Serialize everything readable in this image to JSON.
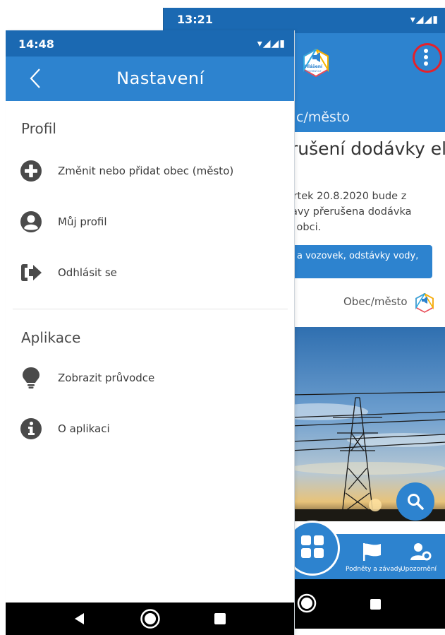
{
  "back_screen": {
    "status_time": "13:21",
    "status_icons": "▾◢◢▮",
    "logo_text_top": "Hlášení",
    "logo_text_bottom": "POCHYBNÝ.CZ",
    "appbar_title": "c/město",
    "headline": "rušení dodávky el.",
    "body_lines": [
      "vrtek 20.8.2020 bude z",
      "ravy přerušena dodávka",
      "é obci."
    ],
    "banner_text": "a vozovek, odstávky vody,",
    "source_label": "Obec/město",
    "nav": {
      "item2_label": "Podněty a závady",
      "item3_label": "Upozornění"
    }
  },
  "front_screen": {
    "status_time": "14:48",
    "status_icons": "▾◢◢▮",
    "title": "Nastavení",
    "sections": [
      {
        "header": "Profil",
        "items": [
          {
            "label": "Změnit nebo přidat obec (město)",
            "icon": "plus-circle-icon"
          },
          {
            "label": "Můj profil",
            "icon": "user-circle-icon"
          },
          {
            "label": "Odhlásit se",
            "icon": "logout-icon"
          }
        ]
      },
      {
        "header": "Aplikace",
        "items": [
          {
            "label": "Zobrazit průvodce",
            "icon": "lightbulb-icon"
          },
          {
            "label": "O aplikaci",
            "icon": "info-icon"
          }
        ]
      }
    ]
  },
  "colors": {
    "status_bar": "#1b69b2",
    "app_bar": "#2d83cf",
    "icon_gray": "#4a4a4a",
    "highlight_ring": "#e5212b"
  }
}
